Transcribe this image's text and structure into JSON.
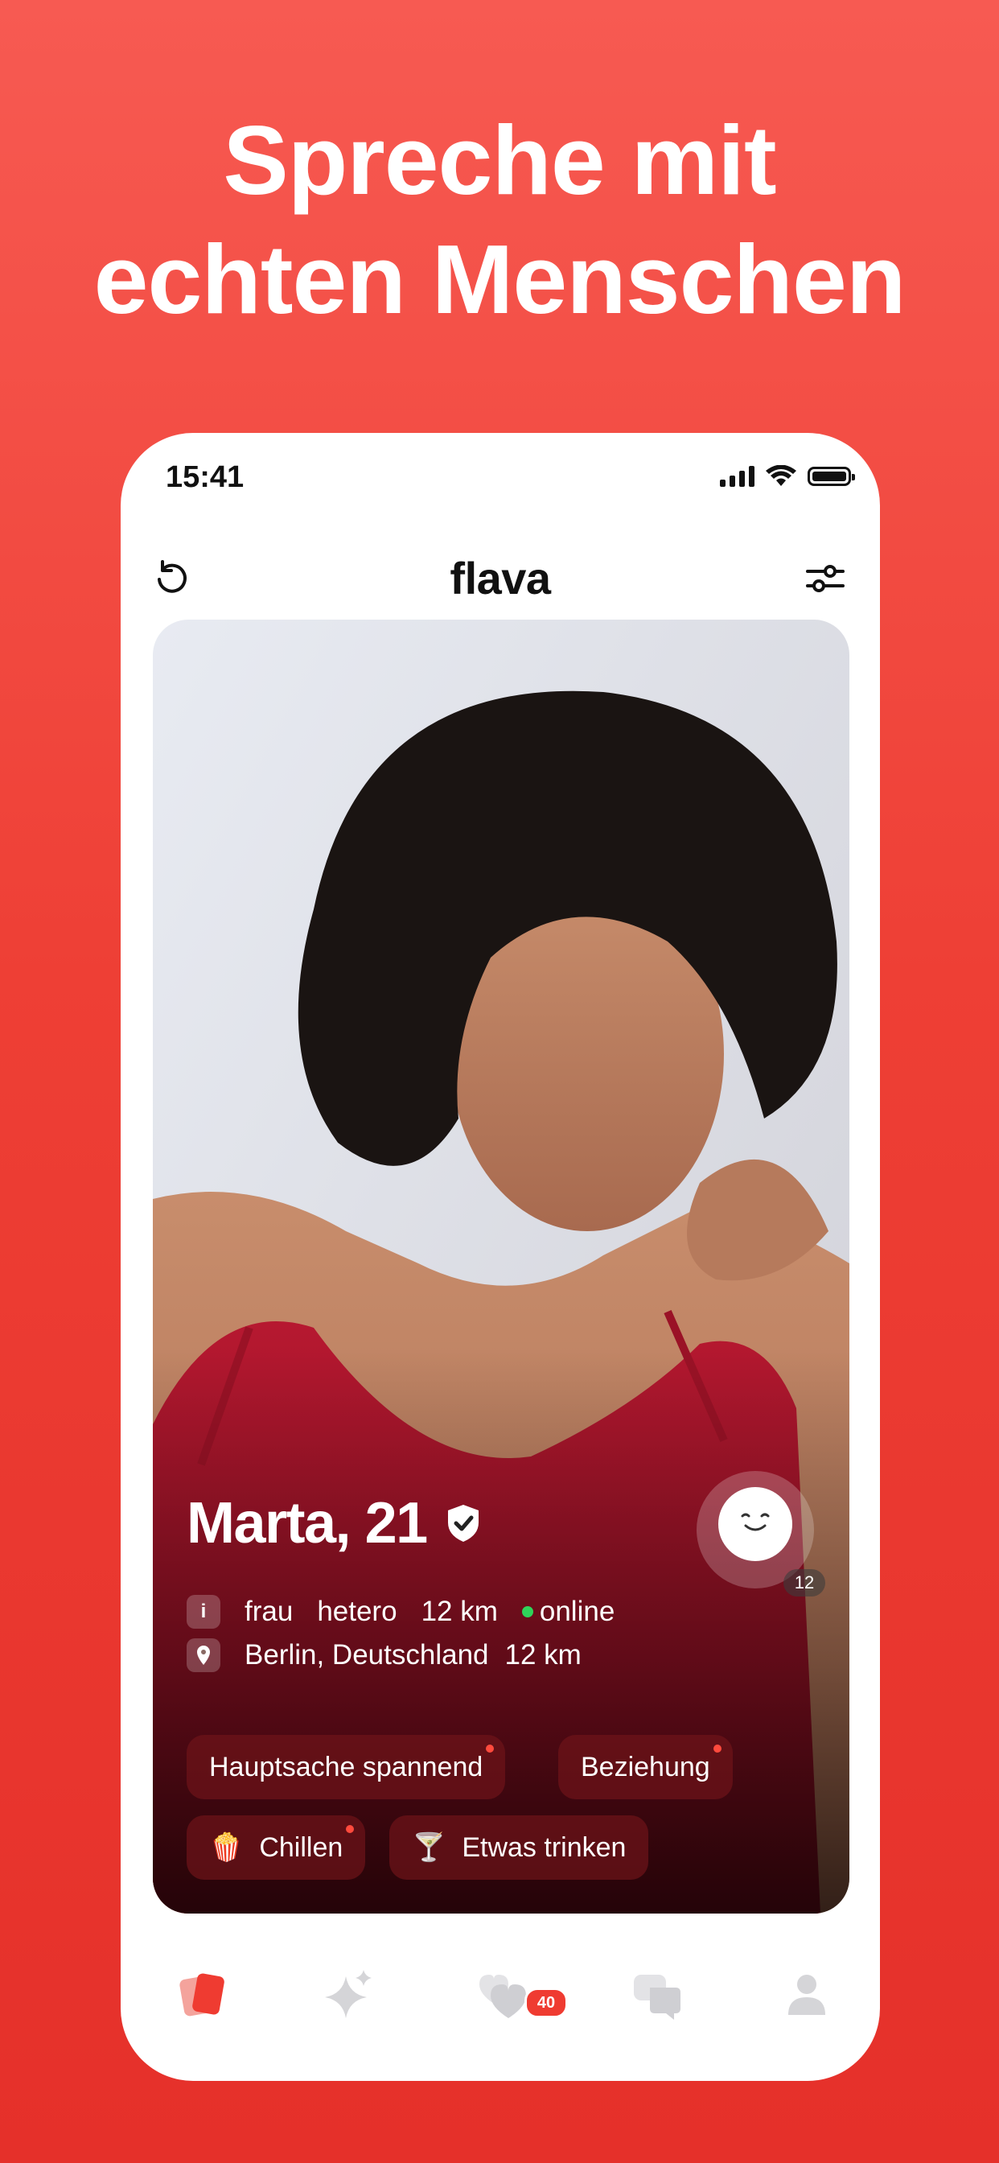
{
  "headline": {
    "line1": "Spreche mit",
    "line2": "echten Menschen"
  },
  "status_bar": {
    "time": "15:41"
  },
  "header": {
    "logo": "flava",
    "left_icon": "undo-icon",
    "right_icon": "filter-icon"
  },
  "profile": {
    "name_age": "Marta, 21",
    "verified": true,
    "avatar_count": "12",
    "info": {
      "gender": "frau",
      "orientation": "hetero",
      "distance": "12 km",
      "status": "online",
      "location": "Berlin, Deutschland",
      "location_distance": "12 km"
    },
    "tags": [
      {
        "label": "Hauptsache spannend",
        "icon": ""
      },
      {
        "label": "Beziehung",
        "icon": ""
      },
      {
        "label": "Chillen",
        "icon": "🍿"
      },
      {
        "label": "Etwas trinken",
        "icon": "🍸"
      }
    ]
  },
  "tabbar": {
    "items": [
      {
        "name": "cards-tab",
        "active": true
      },
      {
        "name": "sparkle-tab",
        "active": false
      },
      {
        "name": "likes-tab",
        "active": false
      },
      {
        "name": "chat-tab",
        "active": false
      },
      {
        "name": "profile-tab",
        "active": false
      }
    ],
    "likes_badge": "40"
  },
  "colors": {
    "brand_red": "#ef3b31",
    "online_green": "#2fd35a"
  }
}
